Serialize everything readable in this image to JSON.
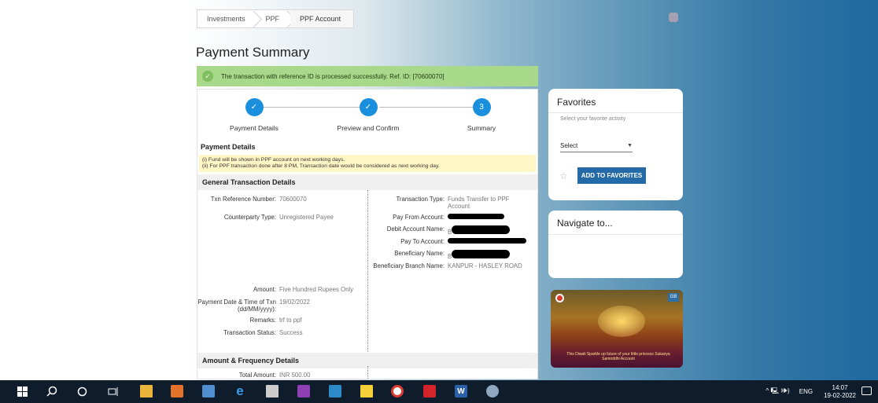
{
  "breadcrumb": {
    "items": [
      "Investments",
      "PPF",
      "PPF Account"
    ]
  },
  "page_title": "Payment Summary",
  "success_message": "The transaction with reference ID is processed successfully. Ref. ID: [70600070]",
  "stepper": {
    "steps": [
      {
        "label": "Payment Details",
        "marker": "✓"
      },
      {
        "label": "Preview and Confirm",
        "marker": "✓"
      },
      {
        "label": "Summary",
        "marker": "3"
      }
    ]
  },
  "payment_details": {
    "heading": "Payment Details",
    "note_1": "(i) Fund will be shown in PPF account on next working days.",
    "note_2": "(ii) For PPF transaction done after 8 PM, Transaction date would be considered as next working day."
  },
  "general": {
    "heading": "General Transaction Details",
    "left": [
      {
        "label": "Txn Reference Number:",
        "value": "70600070"
      },
      {
        "label": "Counterparty Type:",
        "value": "Unregistered Payee"
      },
      {
        "label": "Amount:",
        "value": "Five Hundred Rupees Only"
      },
      {
        "label": "Payment Date & Time of Txn (dd/MM/yyyy):",
        "value": "19/02/2022"
      },
      {
        "label": "Remarks:",
        "value": "trf to ppf"
      },
      {
        "label": "Transaction Status:",
        "value": "Success"
      }
    ],
    "right": [
      {
        "label": "Transaction Type:",
        "value": "Funds Transfer to PPF Account"
      },
      {
        "label": "Pay From Account:",
        "value": ""
      },
      {
        "label": "Debit Account Name:",
        "value": "B"
      },
      {
        "label": "Pay To Account:",
        "value": ""
      },
      {
        "label": "Beneficiary Name:",
        "value": "B"
      },
      {
        "label": "Beneficiary Branch Name:",
        "value": "KANPUR - HASLEY ROAD"
      }
    ]
  },
  "amount": {
    "heading": "Amount & Frequency Details",
    "total_label": "Total Amount:",
    "total_value": "INR 500.00"
  },
  "favorites": {
    "title": "Favorites",
    "subtitle": "Select your favorite activity",
    "select_value": "Select",
    "button": "ADD TO FAVORITES"
  },
  "navigate": {
    "title": "Navigate to..."
  },
  "promo": {
    "caption": "This Diwali Sparkle up future of your little princess Sukanya Samriddhi Account",
    "badge": "GB"
  },
  "taskbar": {
    "language": "ENG",
    "time": "14:07",
    "date": "19-02-2022",
    "tray_icons": "^ 🖳 🕪)"
  }
}
